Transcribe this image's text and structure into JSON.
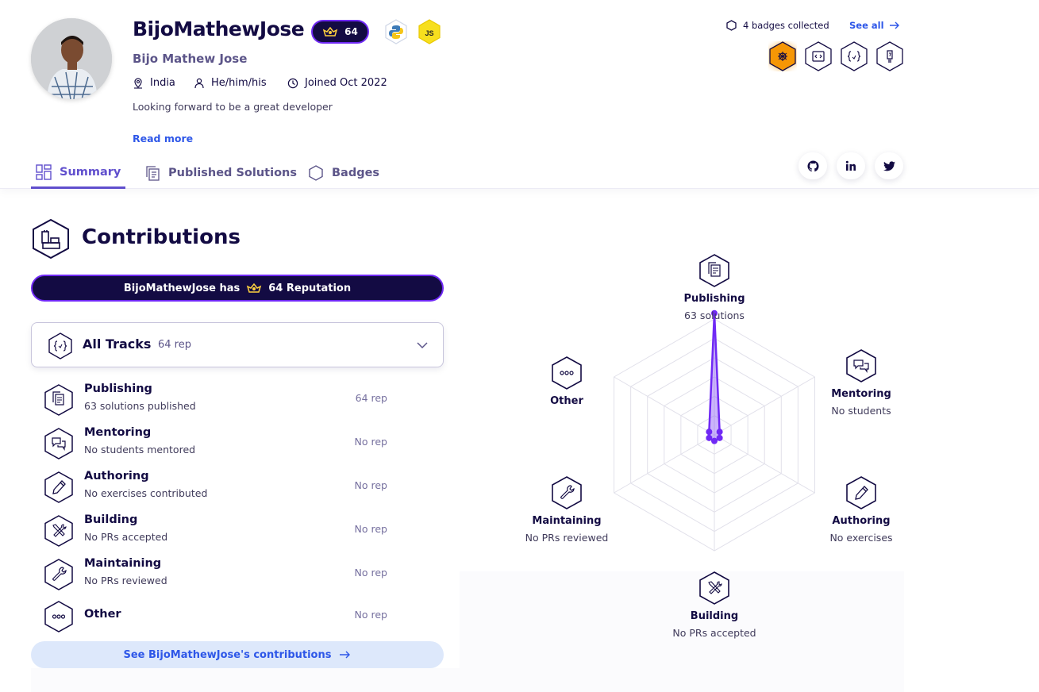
{
  "profile": {
    "handle": "BijoMathewJose",
    "reputation": "64",
    "name": "Bijo Mathew Jose",
    "location": "India",
    "pronouns": "He/him/his",
    "joined": "Joined Oct 2022",
    "bio": "Looking forward to be a great developer",
    "read_more": "Read more",
    "tracks": [
      "python-icon",
      "javascript-icon"
    ],
    "js_label": "JS"
  },
  "badges": {
    "count_label": "4 badges collected",
    "see_all": "See all",
    "items": [
      "bug-badge",
      "code-badge",
      "curly-badge",
      "lightbulb-badge"
    ],
    "accent": "#f69605"
  },
  "tabs": [
    {
      "label": "Summary",
      "active": true
    },
    {
      "label": "Published Solutions",
      "active": false
    },
    {
      "label": "Badges",
      "active": false
    }
  ],
  "social": [
    "github-icon",
    "linkedin-icon",
    "twitter-icon"
  ],
  "contributions": {
    "title": "Contributions",
    "rep_prefix": "BijoMathewJose has",
    "rep_suffix": "64 Reputation",
    "select_label": "All Tracks",
    "select_rep": "64 rep",
    "categories": [
      {
        "name": "Publishing",
        "sub": "63 solutions published",
        "rep": "64 rep"
      },
      {
        "name": "Mentoring",
        "sub": "No students mentored",
        "rep": "No rep"
      },
      {
        "name": "Authoring",
        "sub": "No exercises contributed",
        "rep": "No rep"
      },
      {
        "name": "Building",
        "sub": "No PRs accepted",
        "rep": "No rep"
      },
      {
        "name": "Maintaining",
        "sub": "No PRs reviewed",
        "rep": "No rep"
      },
      {
        "name": "Other",
        "sub": "",
        "rep": "No rep"
      }
    ],
    "see_link": "See BijoMathewJose's contributions"
  },
  "radar": {
    "axes": [
      {
        "name": "Publishing",
        "sub": "63 solutions"
      },
      {
        "name": "Mentoring",
        "sub": "No students"
      },
      {
        "name": "Authoring",
        "sub": "No exercises"
      },
      {
        "name": "Building",
        "sub": "No PRs accepted"
      },
      {
        "name": "Maintaining",
        "sub": "No PRs reviewed"
      },
      {
        "name": "Other",
        "sub": ""
      }
    ],
    "values": [
      1.0,
      0.05,
      0.05,
      0.05,
      0.05,
      0.05
    ],
    "color": "#7029f5"
  },
  "colors": {
    "primary": "#130b43",
    "accent": "#7029f5",
    "link": "#2e57e8",
    "tab_active": "#604fcd"
  }
}
